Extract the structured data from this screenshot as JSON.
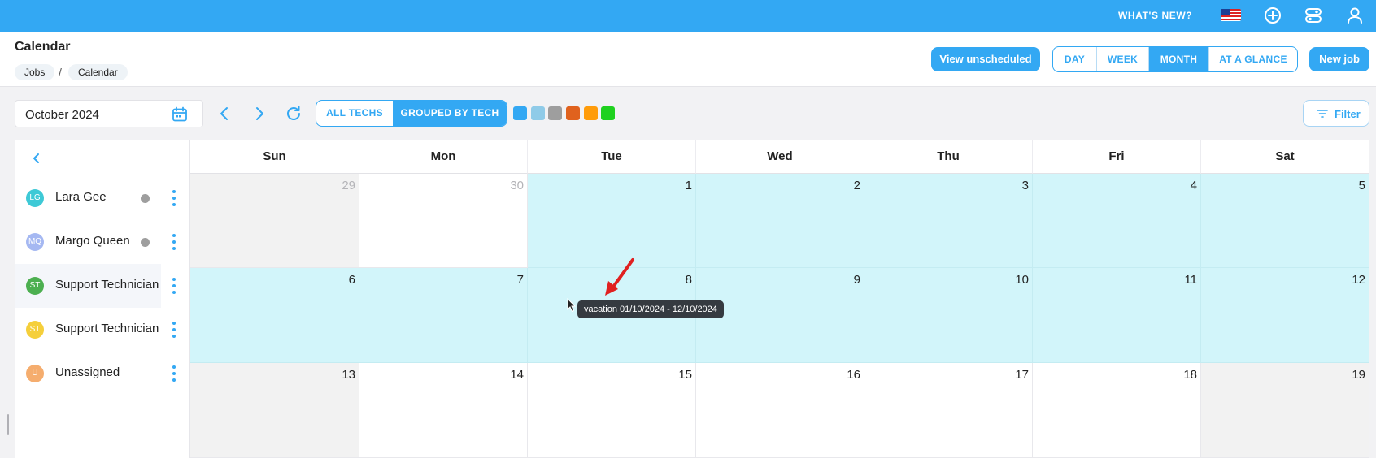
{
  "topbar": {
    "whats_new": "WHAT'S NEW?"
  },
  "header": {
    "title": "Calendar",
    "breadcrumbs": [
      "Jobs",
      "Calendar"
    ],
    "view_unscheduled": "View unscheduled",
    "view_modes": [
      "DAY",
      "WEEK",
      "MONTH",
      "AT A GLANCE"
    ],
    "active_view": "MONTH",
    "new_job": "New job"
  },
  "toolbar": {
    "month": "October 2024",
    "tech_modes": [
      "ALL TECHS",
      "GROUPED BY TECH"
    ],
    "active_tech_mode": "GROUPED BY TECH",
    "swatches": [
      "#33a8f3",
      "#8fcbe8",
      "#9e9e9e",
      "#e0621e",
      "#ff9c0a",
      "#1fd11f"
    ],
    "filter": "Filter"
  },
  "sidebar": {
    "techs": [
      {
        "initials": "LG",
        "name": "Lara Gee",
        "avatar_color": "#3ec9d6",
        "status": true
      },
      {
        "initials": "MQ",
        "name": "Margo Queen",
        "avatar_color": "#a5b8f2",
        "status": true
      },
      {
        "initials": "ST",
        "name": "Support Technician",
        "avatar_color": "#4caf50",
        "status": false,
        "selected": true
      },
      {
        "initials": "ST",
        "name": "Support Technician",
        "avatar_color": "#f5cf3b",
        "status": false
      },
      {
        "initials": "U",
        "name": "Unassigned",
        "avatar_color": "#f5ad6e",
        "status": false
      }
    ]
  },
  "calendar": {
    "days": [
      "Sun",
      "Mon",
      "Tue",
      "Wed",
      "Thu",
      "Fri",
      "Sat"
    ],
    "weeks": [
      [
        "29",
        "30",
        "1",
        "2",
        "3",
        "4",
        "5"
      ],
      [
        "6",
        "7",
        "8",
        "9",
        "10",
        "11",
        "12"
      ],
      [
        "13",
        "14",
        "15",
        "16",
        "17",
        "18",
        "19"
      ]
    ],
    "vacation_color": "#d2f5fa",
    "tooltip": "vacation 01/10/2024 - 12/10/2024"
  }
}
